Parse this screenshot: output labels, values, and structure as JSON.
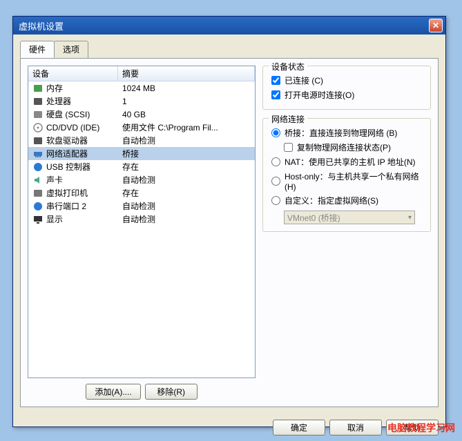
{
  "dialog": {
    "title": "虚拟机设置"
  },
  "tabs": {
    "hardware": "硬件",
    "options": "选项"
  },
  "columns": {
    "device": "设备",
    "summary": "摘要"
  },
  "hw": [
    {
      "name": "内存",
      "summary": "1024 MB",
      "icon": "memory"
    },
    {
      "name": "处理器",
      "summary": "1",
      "icon": "cpu"
    },
    {
      "name": "硬盘 (SCSI)",
      "summary": "40 GB",
      "icon": "disk"
    },
    {
      "name": "CD/DVD (IDE)",
      "summary": "使用文件 C:\\Program Fil...",
      "icon": "cd"
    },
    {
      "name": "软盘驱动器",
      "summary": "自动检测",
      "icon": "floppy"
    },
    {
      "name": "网络适配器",
      "summary": "桥接",
      "icon": "nic",
      "selected": true
    },
    {
      "name": "USB 控制器",
      "summary": "存在",
      "icon": "usb"
    },
    {
      "name": "声卡",
      "summary": "自动检测",
      "icon": "sound"
    },
    {
      "name": "虚拟打印机",
      "summary": "存在",
      "icon": "printer"
    },
    {
      "name": "串行端口 2",
      "summary": "自动检测",
      "icon": "serial"
    },
    {
      "name": "显示",
      "summary": "自动检测",
      "icon": "display"
    }
  ],
  "buttons": {
    "add": "添加(A)....",
    "remove": "移除(R)",
    "ok": "确定",
    "cancel": "取消",
    "help": "帮助"
  },
  "status": {
    "group": "设备状态",
    "connected": "已连接 (C)",
    "connect_poweron": "打开电源时连接(O)"
  },
  "net": {
    "group": "网络连接",
    "bridged": "桥接：直接连接到物理网络 (B)",
    "replicate": "复制物理网络连接状态(P)",
    "nat": "NAT：使用已共享的主机 IP 地址(N)",
    "hostonly": "Host-only：与主机共享一个私有网络(H)",
    "custom": "自定义：指定虚拟网络(S)",
    "vnet": "VMnet0 (桥接)"
  },
  "watermark": "电脑教程学习网"
}
